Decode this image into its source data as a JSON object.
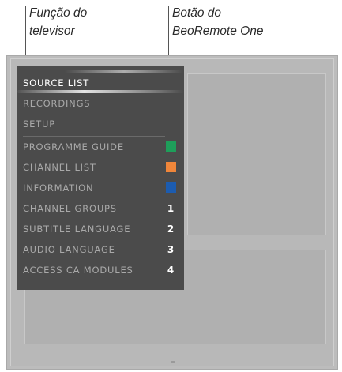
{
  "annotations": {
    "tv_function_line1": "Função do",
    "tv_function_line2": "televisor",
    "remote_button_line1": "Botão do",
    "remote_button_line2": "BeoRemote One"
  },
  "menu": {
    "items": [
      {
        "label": "SOURCE LIST",
        "selected": true
      },
      {
        "label": "RECORDINGS"
      },
      {
        "label": "SETUP"
      },
      {
        "label": "PROGRAMME GUIDE",
        "swatch": "#1e9e5a"
      },
      {
        "label": "CHANNEL LIST",
        "swatch": "#f0863a"
      },
      {
        "label": "INFORMATION",
        "swatch": "#1c5cb0"
      },
      {
        "label": "CHANNEL GROUPS",
        "number": "1"
      },
      {
        "label": "SUBTITLE LANGUAGE",
        "number": "2"
      },
      {
        "label": "AUDIO LANGUAGE",
        "number": "3"
      },
      {
        "label": "ACCESS CA MODULES",
        "number": "4"
      }
    ]
  },
  "colors": {
    "menu_background": "#4b4b4b",
    "tv_background": "#bcbcbc"
  }
}
